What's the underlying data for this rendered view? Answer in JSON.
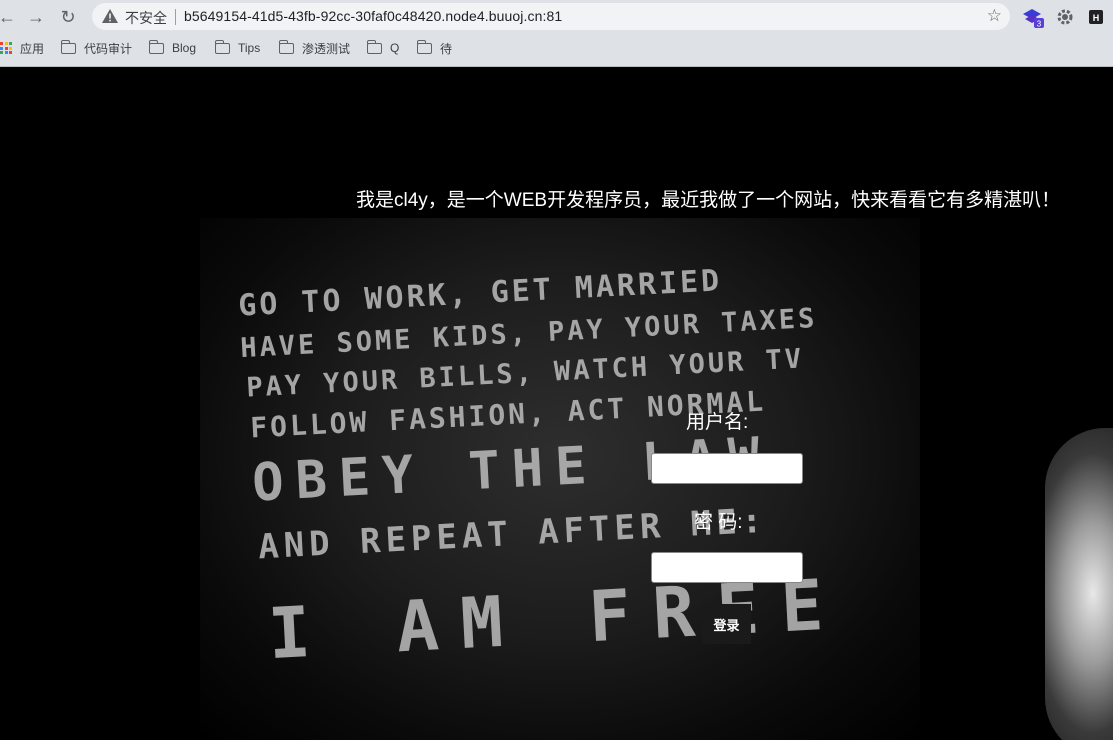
{
  "browser": {
    "security_label": "不安全",
    "url": "b5649154-41d5-43fb-92cc-30faf0c48420.node4.buuoj.cn:81",
    "extension_badge": "3",
    "bookmarks": [
      {
        "label": "应用",
        "icon": "apps-grid-icon"
      },
      {
        "label": "代码审计",
        "icon": "folder-icon"
      },
      {
        "label": "Blog",
        "icon": "folder-icon"
      },
      {
        "label": "Tips",
        "icon": "folder-icon"
      },
      {
        "label": "渗透测试",
        "icon": "folder-icon"
      },
      {
        "label": "Q",
        "icon": "folder-icon"
      },
      {
        "label": "待",
        "icon": "folder-icon"
      }
    ]
  },
  "page": {
    "intro": "我是cl4y，是一个WEB开发程序员，最近我做了一个网站，快来看看它有多精湛叭！",
    "poster_lines": [
      "GO TO WORK, GET MARRIED",
      "HAVE SOME KIDS, PAY YOUR TAXES",
      "PAY YOUR BILLS, WATCH YOUR TV",
      "FOLLOW FASHION, ACT NORMAL",
      "OBEY THE LAW",
      "AND REPEAT AFTER ME:",
      "I AM FREE"
    ],
    "form": {
      "username_label": "用户名:",
      "username_value": "",
      "password_label": "密 码:",
      "password_value": "",
      "submit_label": "登录"
    }
  }
}
